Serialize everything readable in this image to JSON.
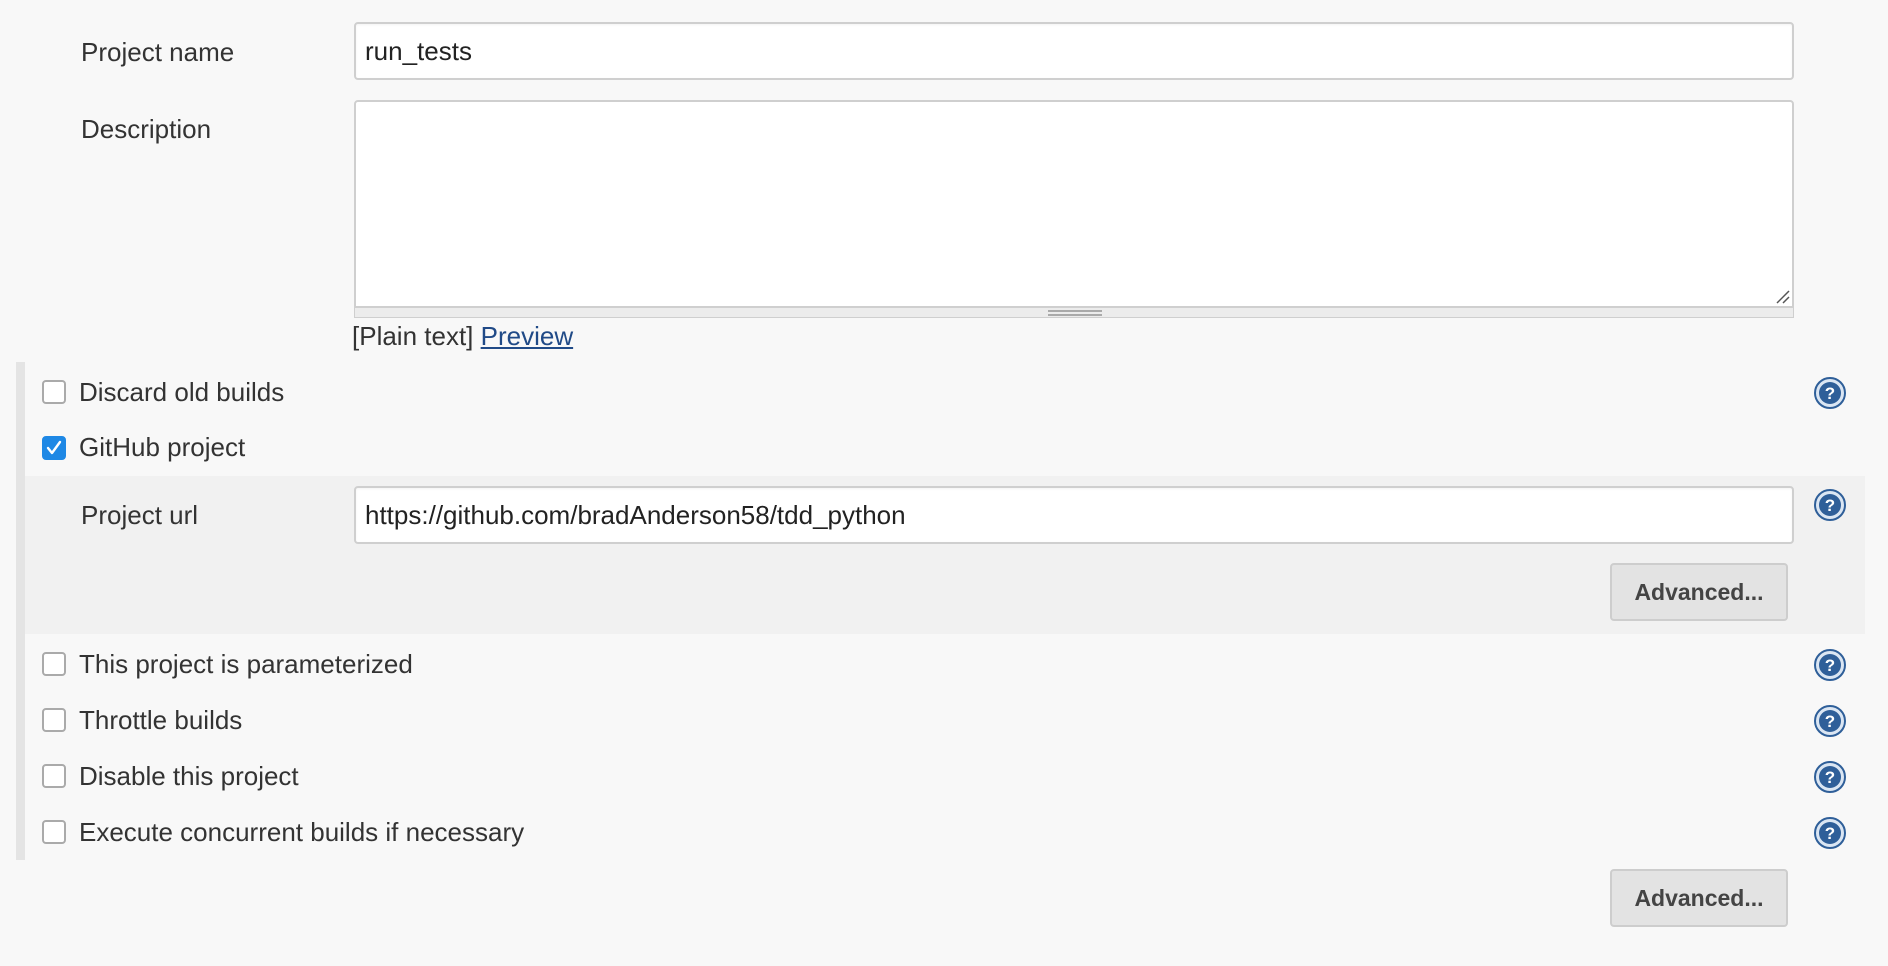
{
  "project_name": {
    "label": "Project name",
    "value": "run_tests"
  },
  "description": {
    "label": "Description",
    "value": "",
    "markup_text": "[Plain text]",
    "preview_link": "Preview"
  },
  "options": [
    {
      "label": "Discard old builds",
      "checked": false
    },
    {
      "label": "GitHub project",
      "checked": true
    },
    {
      "label": "This project is parameterized",
      "checked": false
    },
    {
      "label": "Throttle builds",
      "checked": false
    },
    {
      "label": "Disable this project",
      "checked": false
    },
    {
      "label": "Execute concurrent builds if necessary",
      "checked": false
    }
  ],
  "github": {
    "project_url_label": "Project url",
    "project_url_value": "https://github.com/bradAnderson58/tdd_python",
    "advanced_label": "Advanced..."
  },
  "footer": {
    "advanced_label": "Advanced..."
  },
  "colors": {
    "background": "#f8f8f8",
    "checkbox_checked": "#1e88e5",
    "link": "#204a87",
    "help_icon": "#2f5f99"
  },
  "icons": {
    "help": "help-question-icon",
    "check": "checkmark-icon",
    "resize": "resize-grip-icon"
  }
}
